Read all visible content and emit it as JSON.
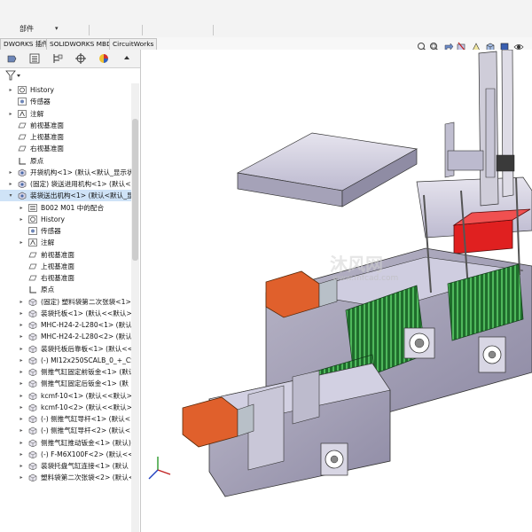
{
  "ribbon": {
    "parts_label": "部件"
  },
  "tabs": [
    {
      "label": "DWORKS 插件"
    },
    {
      "label": "SOLIDWORKS MBD"
    },
    {
      "label": "CircuitWorks"
    }
  ],
  "tree": {
    "rows": [
      {
        "label": "History",
        "depth": 1,
        "icon": "history-icon",
        "expander": "right"
      },
      {
        "label": "传感器",
        "depth": 1,
        "icon": "sensor-icon",
        "expander": ""
      },
      {
        "label": "注解",
        "depth": 1,
        "icon": "annotation-icon",
        "expander": "right"
      },
      {
        "label": "前视基准面",
        "depth": 1,
        "icon": "plane-icon",
        "expander": ""
      },
      {
        "label": "上视基准面",
        "depth": 1,
        "icon": "plane-icon",
        "expander": ""
      },
      {
        "label": "右视基准面",
        "depth": 1,
        "icon": "plane-icon",
        "expander": ""
      },
      {
        "label": "原点",
        "depth": 1,
        "icon": "origin-icon",
        "expander": ""
      },
      {
        "label": "开袋机构<1> (默认<默认_显示状",
        "depth": 1,
        "icon": "subassembly-icon",
        "expander": "right"
      },
      {
        "label": "(固定) 袋送进用机构<1> (默认<默",
        "depth": 1,
        "icon": "subassembly-icon",
        "expander": "right"
      },
      {
        "label": "装袋送出机构<1> (默认<默认_显示",
        "depth": 1,
        "icon": "subassembly-icon",
        "expander": "down",
        "selected": true
      },
      {
        "label": "B002 M01 中的配合",
        "depth": 2,
        "icon": "mates-icon",
        "expander": "right"
      },
      {
        "label": "History",
        "depth": 2,
        "icon": "history-icon",
        "expander": "right"
      },
      {
        "label": "传感器",
        "depth": 2,
        "icon": "sensor-icon",
        "expander": ""
      },
      {
        "label": "注解",
        "depth": 2,
        "icon": "annotation-icon",
        "expander": "right"
      },
      {
        "label": "前视基准面",
        "depth": 2,
        "icon": "plane-icon",
        "expander": ""
      },
      {
        "label": "上视基准面",
        "depth": 2,
        "icon": "plane-icon",
        "expander": ""
      },
      {
        "label": "右视基准面",
        "depth": 2,
        "icon": "plane-icon",
        "expander": ""
      },
      {
        "label": "原点",
        "depth": 2,
        "icon": "origin-icon",
        "expander": ""
      },
      {
        "label": "(固定) 塑料袋第二次张袋<1>",
        "depth": 2,
        "icon": "part-icon",
        "expander": "right"
      },
      {
        "label": "装袋托板<1> (默认<<默认>_",
        "depth": 2,
        "icon": "part-icon",
        "expander": "right"
      },
      {
        "label": "MHC-H24-2-L280<1> (默认",
        "depth": 2,
        "icon": "part-icon",
        "expander": "right"
      },
      {
        "label": "MHC-H24-2-L280<2> (默认",
        "depth": 2,
        "icon": "part-icon",
        "expander": "right"
      },
      {
        "label": "装袋托板后靠板<1> (默认<<",
        "depth": 2,
        "icon": "part-icon",
        "expander": "right"
      },
      {
        "label": "(-) MI12x250SCALB_0_+_CS",
        "depth": 2,
        "icon": "part-icon",
        "expander": "right"
      },
      {
        "label": "侧推气缸固定前钣金<1> (默认",
        "depth": 2,
        "icon": "part-icon",
        "expander": "right"
      },
      {
        "label": "侧推气缸固定后钣金<1> (默",
        "depth": 2,
        "icon": "part-icon",
        "expander": "right"
      },
      {
        "label": "kcmf-10<1> (默认<<默认>_",
        "depth": 2,
        "icon": "part-icon",
        "expander": "right"
      },
      {
        "label": "kcmf-10<2> (默认<<默认>_",
        "depth": 2,
        "icon": "part-icon",
        "expander": "right"
      },
      {
        "label": "(-) 侧推气缸导杆<1> (默认<",
        "depth": 2,
        "icon": "part-icon",
        "expander": "right"
      },
      {
        "label": "(-) 侧推气缸导杆<2> (默认<",
        "depth": 2,
        "icon": "part-icon",
        "expander": "right"
      },
      {
        "label": "侧推气缸推动钣金<1> (默认)",
        "depth": 2,
        "icon": "part-icon",
        "expander": "right"
      },
      {
        "label": "(-) F-M6X100F<2> (默认<<",
        "depth": 2,
        "icon": "part-icon",
        "expander": "right"
      },
      {
        "label": "装袋托盘气缸连接<1> (默认",
        "depth": 2,
        "icon": "part-icon",
        "expander": "right"
      },
      {
        "label": "塑料袋第二次张袋<2> (默认<",
        "depth": 2,
        "icon": "part-icon",
        "expander": "right"
      }
    ]
  },
  "watermark": {
    "brand": "沐风网",
    "url": "www.mfcad.com"
  },
  "colors": {
    "selection": "#cfe3f7",
    "frame": "#9a96ad",
    "red_part": "#e02020",
    "orange_part": "#e0602c",
    "green_belt": "#2e8b3a"
  }
}
